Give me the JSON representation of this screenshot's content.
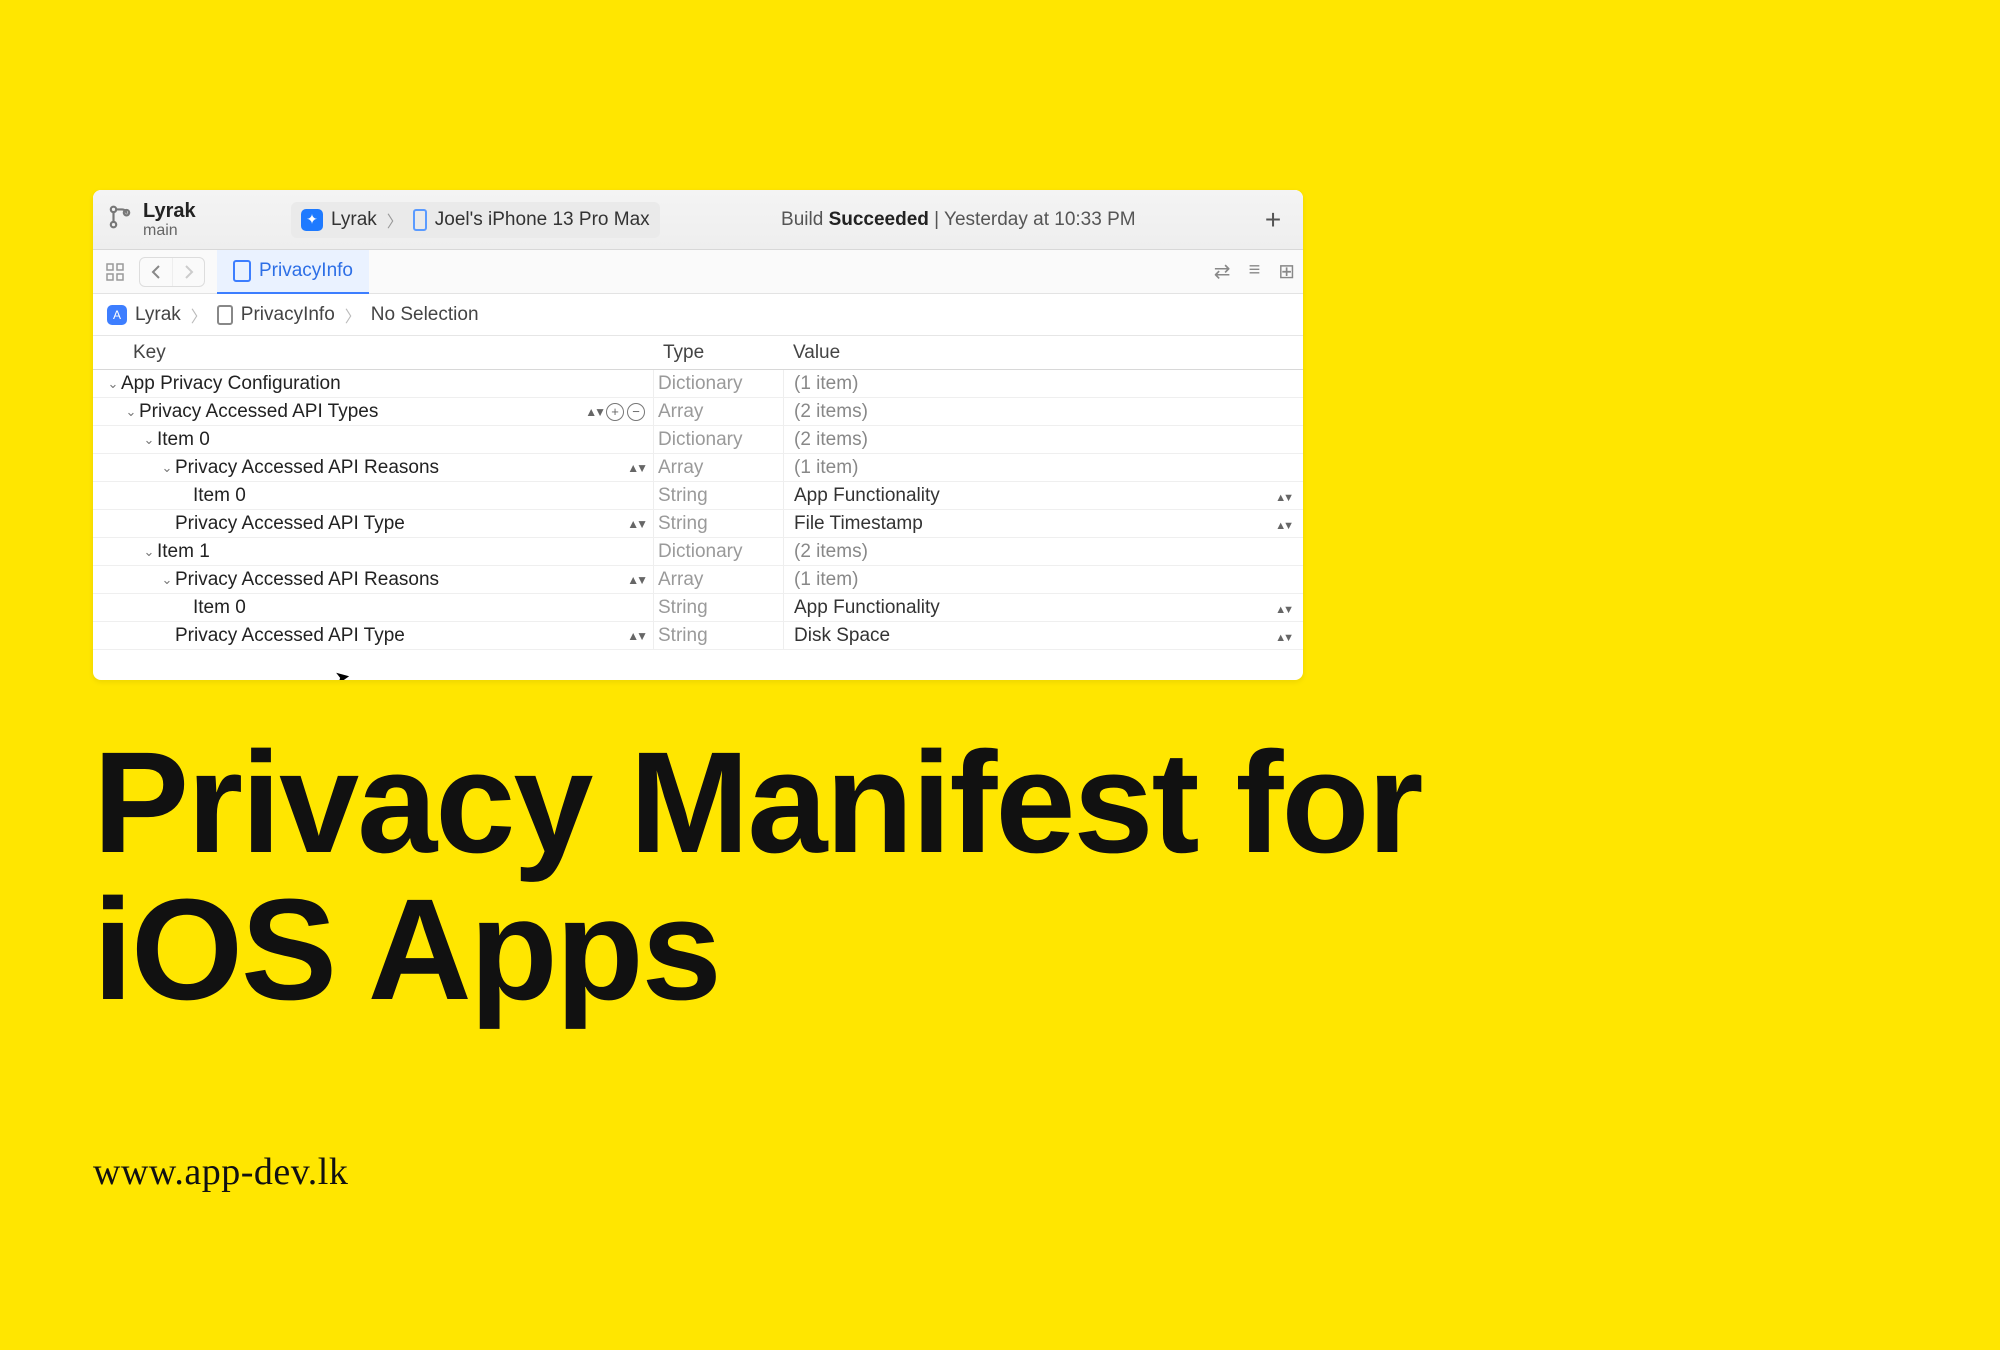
{
  "headline": {
    "line1": "Privacy Manifest for",
    "line2": "iOS Apps"
  },
  "site_url": "www.app-dev.lk",
  "toolbar": {
    "branch_name": "Lyrak",
    "branch_sub": "main",
    "scheme_name": "Lyrak",
    "device_name": "Joel's iPhone 13 Pro Max",
    "status_prefix": "Build ",
    "status_bold": "Succeeded",
    "status_suffix": " | Yesterday at 10:33 PM"
  },
  "tab": {
    "file_name": "PrivacyInfo"
  },
  "breadcrumb": {
    "app": "Lyrak",
    "file": "PrivacyInfo",
    "selection": "No Selection"
  },
  "columns": {
    "key": "Key",
    "type": "Type",
    "value": "Value"
  },
  "rows": [
    {
      "indent": 0,
      "disclosure": "down",
      "key": "App Privacy Configuration",
      "type": "Dictionary",
      "value": "(1 item)",
      "muted_value": true
    },
    {
      "indent": 1,
      "disclosure": "down",
      "key": "Privacy Accessed API Types",
      "type": "Array",
      "value": "(2 items)",
      "muted_value": true,
      "key_controls": true
    },
    {
      "indent": 2,
      "disclosure": "down",
      "key": "Item 0",
      "type": "Dictionary",
      "value": "(2 items)",
      "muted_value": true
    },
    {
      "indent": 3,
      "disclosure": "down",
      "key": "Privacy Accessed API Reasons",
      "type": "Array",
      "value": "(1 item)",
      "muted_value": true,
      "key_chev": true
    },
    {
      "indent": 4,
      "disclosure": "none",
      "key": "Item 0",
      "type": "String",
      "value": "App Functionality",
      "value_chev": true
    },
    {
      "indent": 3,
      "disclosure": "none",
      "key": "Privacy Accessed API Type",
      "type": "String",
      "value": "File Timestamp",
      "key_chev": true,
      "value_chev": true
    },
    {
      "indent": 2,
      "disclosure": "down",
      "key": "Item 1",
      "type": "Dictionary",
      "value": "(2 items)",
      "muted_value": true
    },
    {
      "indent": 3,
      "disclosure": "down",
      "key": "Privacy Accessed API Reasons",
      "type": "Array",
      "value": "(1 item)",
      "muted_value": true,
      "key_chev": true
    },
    {
      "indent": 4,
      "disclosure": "none",
      "key": "Item 0",
      "type": "String",
      "value": "App Functionality",
      "value_chev": true
    },
    {
      "indent": 3,
      "disclosure": "none",
      "key": "Privacy Accessed API Type",
      "type": "String",
      "value": "Disk Space",
      "key_chev": true,
      "value_chev": true
    }
  ]
}
